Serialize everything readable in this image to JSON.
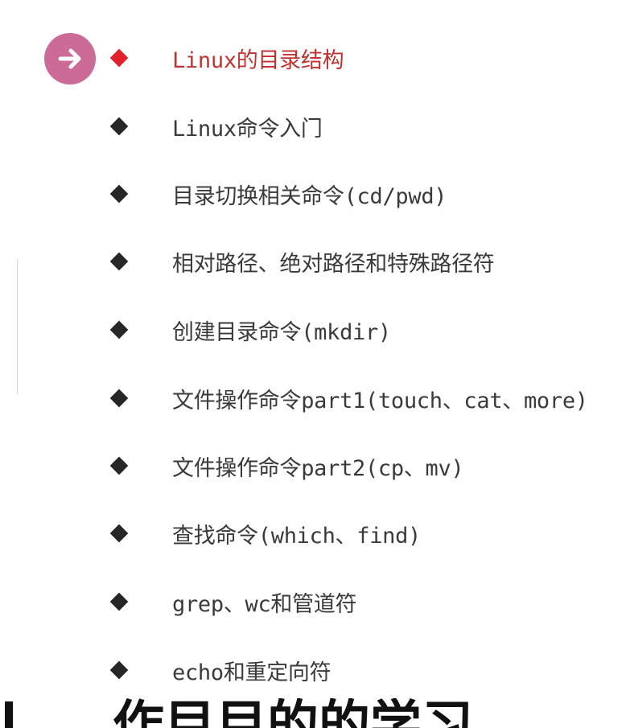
{
  "agenda": {
    "items": [
      {
        "label": "Linux的目录结构",
        "active": true
      },
      {
        "label": "Linux命令入门",
        "active": false
      },
      {
        "label": "目录切换相关命令(cd/pwd)",
        "active": false
      },
      {
        "label": "相对路径、绝对路径和特殊路径符",
        "active": false
      },
      {
        "label": "创建目录命令(mkdir)",
        "active": false
      },
      {
        "label": "文件操作命令part1(touch、cat、more)",
        "active": false
      },
      {
        "label": "文件操作命令part2(cp、mv)",
        "active": false
      },
      {
        "label": "查找命令(which、find)",
        "active": false
      },
      {
        "label": "grep、wc和管道符",
        "active": false
      },
      {
        "label": "echo和重定向符",
        "active": false
      }
    ]
  },
  "bottom_banner": {
    "text": "作目目的的学习"
  },
  "icons": {
    "current_indicator": "arrow-right-circle-icon",
    "bullet": "diamond-bullet-icon"
  },
  "colors": {
    "indicator_circle": "#cc6a98",
    "active_text": "#c03330",
    "active_bullet": "#e0202a",
    "text": "#3a3a3a",
    "bullet": "#262626"
  }
}
